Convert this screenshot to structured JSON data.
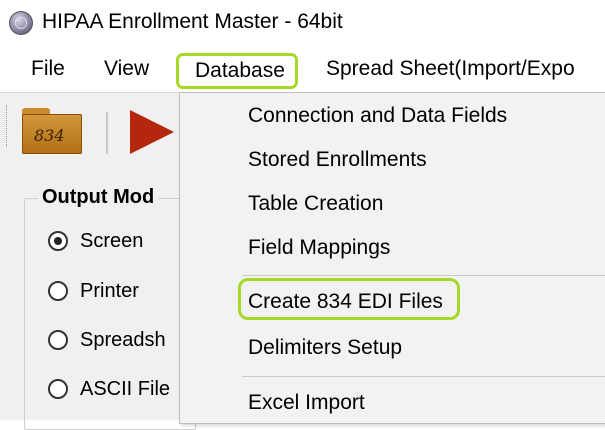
{
  "window": {
    "title": "HIPAA Enrollment Master - 64bit"
  },
  "menubar": {
    "items": [
      {
        "label": "File"
      },
      {
        "label": "View"
      },
      {
        "label": "Database"
      },
      {
        "label": "Spread Sheet(Import/Expo"
      }
    ]
  },
  "toolbar": {
    "open_834_label": "834",
    "icons": [
      "folder-834-icon",
      "play-icon"
    ]
  },
  "output_mode": {
    "title": "Output Mod",
    "options": [
      {
        "label": "Screen",
        "checked": true
      },
      {
        "label": "Printer",
        "checked": false
      },
      {
        "label": "Spreadsh",
        "checked": false
      },
      {
        "label": "ASCII File",
        "checked": false
      }
    ]
  },
  "database_menu": {
    "items": [
      {
        "label": "Connection and Data Fields"
      },
      {
        "label": "Stored Enrollments"
      },
      {
        "label": "Table Creation"
      },
      {
        "label": "Field Mappings"
      },
      {
        "label": "Create 834 EDI Files"
      },
      {
        "label": "Delimiters Setup"
      },
      {
        "label": "Excel Import"
      }
    ]
  },
  "colors": {
    "highlight": "#a6d82a",
    "menu_background": "#f2f2f2",
    "play_icon": "#b5260f"
  }
}
